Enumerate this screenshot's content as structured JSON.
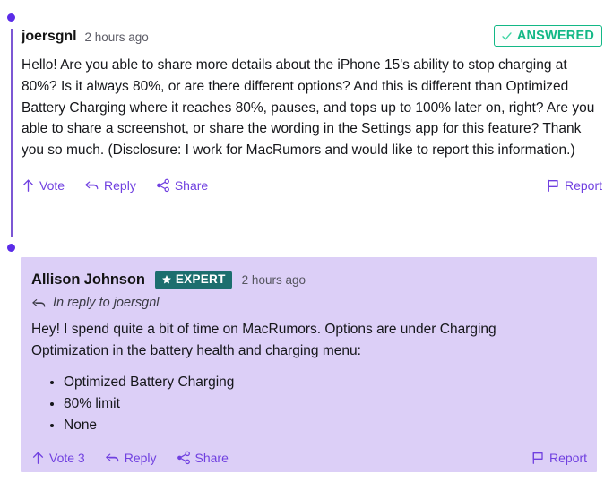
{
  "theme": {
    "accent_purple": "#7040E0",
    "thread_line": "#7C57D4",
    "node_dot": "#5B2CE8",
    "answered_green": "#12B886",
    "expert_teal": "#1C6E6E",
    "reply_card_bg": "#DCCFF7",
    "page_bg": "#FFFFFF",
    "text_color": "#15161A"
  },
  "comment": {
    "author": "joersgnl",
    "timestamp": "2 hours ago",
    "status_badge": {
      "label": "ANSWERED",
      "icon": "check-icon"
    },
    "text": "Hello! Are you able to share more details about the iPhone 15's ability to stop charging at 80%? Is it always 80%, or are there different options? And this is different than Optimized Battery Charging where it reaches 80%, pauses, and tops up to 100% later on, right? Are you able to share a screenshot, or share the wording in the Settings app for this feature? Thank you so much. (Disclosure: I work for MacRumors and would like to report this information.)",
    "actions": {
      "vote": "Vote",
      "reply": "Reply",
      "share": "Share",
      "report": "Report"
    }
  },
  "reply": {
    "author": "Allison Johnson",
    "expert_badge": {
      "label": "EXPERT",
      "icon": "star-icon"
    },
    "timestamp": "2 hours ago",
    "in_reply_to": "In reply to joersgnl",
    "text": "Hey! I spend quite a bit of time on MacRumors. Options are under Charging Optimization in the battery health and charging menu:",
    "options": [
      "Optimized Battery Charging",
      "80% limit",
      "None"
    ],
    "actions": {
      "vote": "Vote 3",
      "reply": "Reply",
      "share": "Share",
      "report": "Report"
    }
  }
}
